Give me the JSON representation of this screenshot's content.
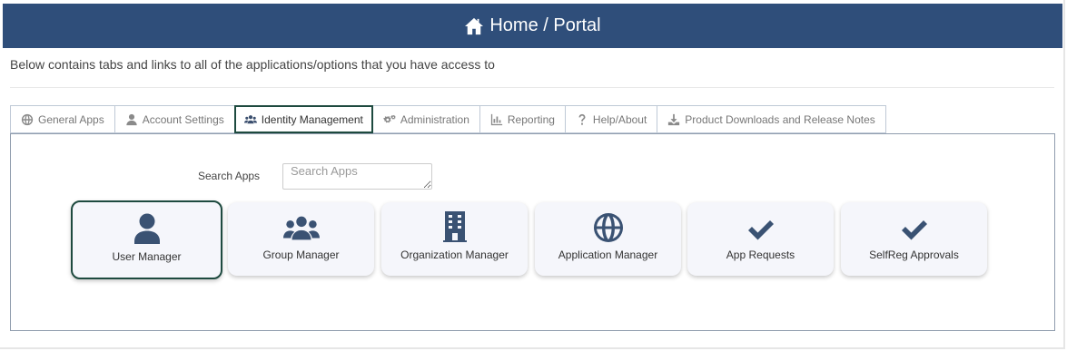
{
  "header": {
    "title": "Home / Portal",
    "icon": "home-icon"
  },
  "subtitle": "Below contains tabs and links to all of the applications/options that you have access to",
  "tabs": [
    {
      "label": "General Apps",
      "icon": "globe-icon"
    },
    {
      "label": "Account Settings",
      "icon": "user-icon"
    },
    {
      "label": "Identity Management",
      "icon": "users-icon",
      "active": true
    },
    {
      "label": "Administration",
      "icon": "gears-icon"
    },
    {
      "label": "Reporting",
      "icon": "bar-chart-icon"
    },
    {
      "label": "Help/About",
      "icon": "question-icon"
    },
    {
      "label": "Product Downloads and Release Notes",
      "icon": "download-icon"
    }
  ],
  "search": {
    "label": "Search Apps",
    "placeholder": "Search Apps",
    "value": ""
  },
  "apps": [
    {
      "label": "User Manager",
      "icon": "user-icon",
      "selected": true
    },
    {
      "label": "Group Manager",
      "icon": "users-icon"
    },
    {
      "label": "Organization Manager",
      "icon": "building-icon"
    },
    {
      "label": "Application Manager",
      "icon": "globe-icon"
    },
    {
      "label": "App Requests",
      "icon": "checkmark-icon"
    },
    {
      "label": "SelfReg Approvals",
      "icon": "checkmark-icon"
    }
  ],
  "colors": {
    "header_bg": "#2f4e7a",
    "icon": "#3a5273",
    "active_border": "#1e4a3f"
  }
}
